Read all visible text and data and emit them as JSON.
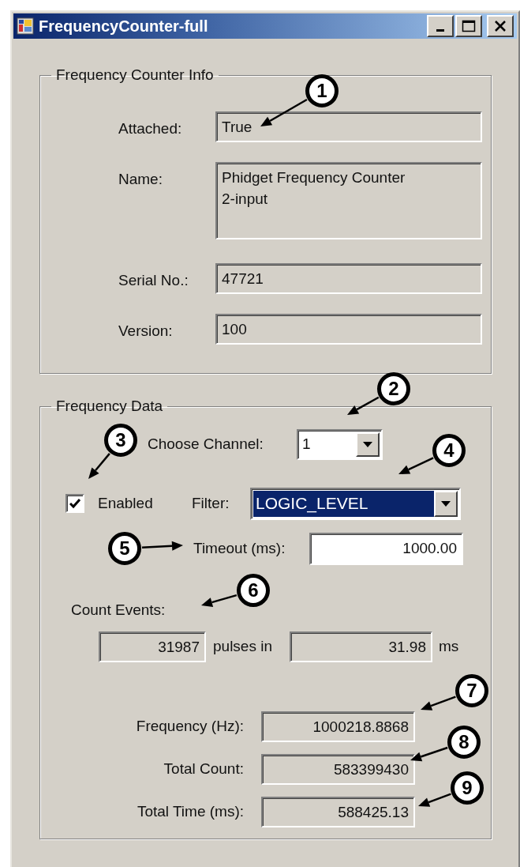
{
  "window": {
    "title": "FrequencyCounter-full"
  },
  "info_group": {
    "title": "Frequency Counter Info",
    "fields": [
      {
        "label": "Attached:",
        "value": "True",
        "read_only": true
      },
      {
        "label": "Name:",
        "value": "Phidget Frequency Counter\n2-input",
        "read_only": true
      },
      {
        "label": "Serial No.:",
        "value": "47721",
        "read_only": true
      },
      {
        "label": "Version:",
        "value": "100",
        "read_only": true
      }
    ]
  },
  "data_group": {
    "title": "Frequency Data",
    "channel": {
      "label": "Choose Channel:",
      "value": "1"
    },
    "enabled": {
      "label": "Enabled",
      "checked": true
    },
    "filter": {
      "label": "Filter:",
      "value": "LOGIC_LEVEL",
      "highlighted": true
    },
    "timeout": {
      "label": "Timeout (ms):",
      "value": "1000.00",
      "read_only": false
    },
    "count_events": {
      "label": "Count Events:",
      "pulses": {
        "value": "31987",
        "read_only": true
      },
      "pulses_label": "pulses in",
      "time": {
        "value": "31.98",
        "read_only": true
      },
      "time_label": "ms"
    },
    "results": [
      {
        "label": "Frequency (Hz):",
        "value": "1000218.8868",
        "read_only": true
      },
      {
        "label": "Total Count:",
        "value": "583399430",
        "read_only": true
      },
      {
        "label": "Total Time (ms):",
        "value": "588425.13",
        "read_only": true
      }
    ]
  },
  "callouts": [
    {
      "number": "1"
    },
    {
      "number": "2"
    },
    {
      "number": "3"
    },
    {
      "number": "4"
    },
    {
      "number": "5"
    },
    {
      "number": "6"
    },
    {
      "number": "7"
    },
    {
      "number": "8"
    },
    {
      "number": "9"
    }
  ]
}
